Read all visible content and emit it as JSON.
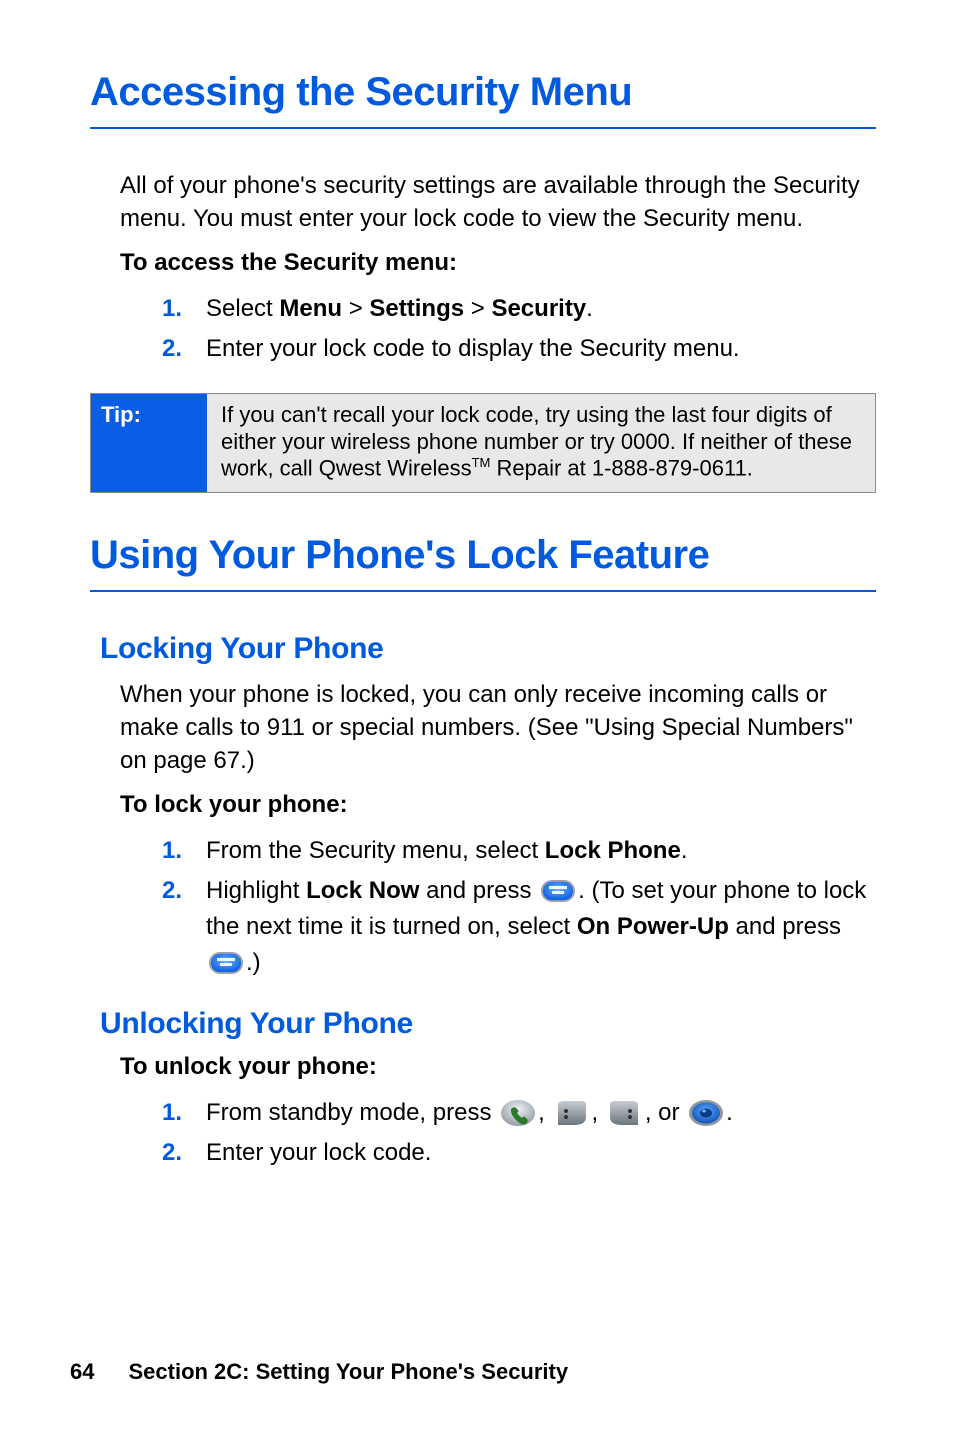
{
  "section1": {
    "title": "Accessing the Security Menu",
    "intro": "All of your phone's security settings are available through the Security menu. You must enter your lock code to view the Security menu.",
    "lead": "To access the Security menu:",
    "steps": {
      "s1_prefix": "Select ",
      "s1_menu": "Menu",
      "s1_gt1": " > ",
      "s1_settings": "Settings",
      "s1_gt2": " > ",
      "s1_security": "Security",
      "s1_suffix": ".",
      "s2": "Enter your lock code to display the Security menu."
    }
  },
  "tip": {
    "label": "Tip:",
    "body_pre": "If you can't recall your lock code, try using the last four digits of either your wireless phone number or try 0000. If neither of these work, call Qwest Wireless",
    "body_tm": "TM",
    "body_post": " Repair at 1-888-879-0611."
  },
  "section2": {
    "title": "Using Your Phone's Lock Feature",
    "locking": {
      "title": "Locking Your Phone",
      "intro": "When your phone is locked, you can only receive incoming calls or make calls to 911 or special numbers. (See \"Using Special Numbers\" on page 67.)",
      "lead": "To lock your phone:",
      "s1_pre": "From the Security menu, select ",
      "s1_bold": "Lock Phone",
      "s1_post": ".",
      "s2_pre": "Highlight ",
      "s2_bold1": "Lock Now",
      "s2_mid1": " and press ",
      "s2_mid2": ". (To set your phone to lock the next time it is turned on, select ",
      "s2_bold2": "On Power-Up",
      "s2_mid3": " and press ",
      "s2_post": ".)"
    },
    "unlocking": {
      "title": "Unlocking Your Phone",
      "lead": "To unlock your phone:",
      "s1_pre": "From standby mode, press ",
      "s1_c1": ", ",
      "s1_c2": ", ",
      "s1_c3": ", or ",
      "s1_post": ".",
      "s2": "Enter your lock code."
    }
  },
  "footer": {
    "page": "64",
    "text": "Section 2C: Setting Your Phone's Security"
  }
}
